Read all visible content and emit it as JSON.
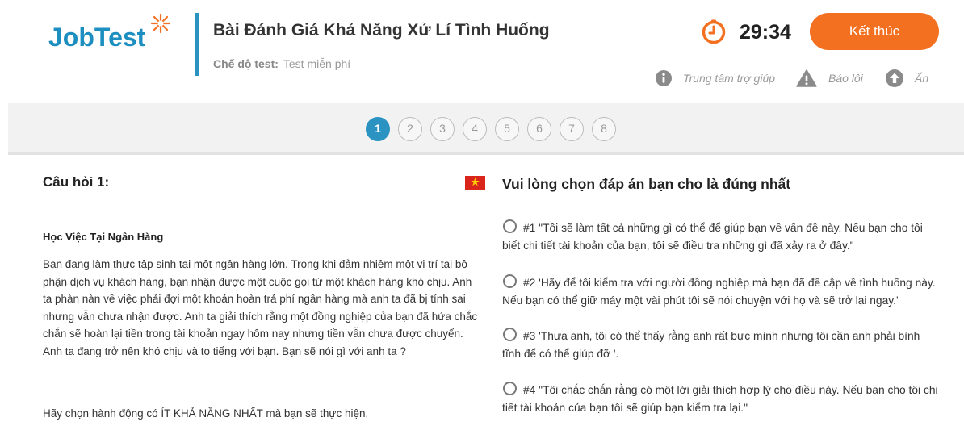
{
  "brand": {
    "logo_text": "JobTest",
    "accent": "#1c8fc0",
    "star_color": "#f37021"
  },
  "header": {
    "title": "Bài Đánh Giá Khả Năng Xử Lí Tình Huống",
    "mode_label": "Chế độ test:",
    "mode_value": "Test miễn phí",
    "timer": "29:34",
    "finish_button": "Kết thúc",
    "tools": {
      "help": {
        "label": "Trung tâm trợ giúp",
        "icon": "info-icon"
      },
      "report": {
        "label": "Báo lỗi",
        "icon": "warning-icon"
      },
      "hide": {
        "label": "Ẩn",
        "icon": "arrow-up-icon"
      }
    }
  },
  "pagination": {
    "pages": [
      "1",
      "2",
      "3",
      "4",
      "5",
      "6",
      "7",
      "8"
    ],
    "current": "1",
    "active_color": "#2b93c1"
  },
  "question": {
    "number_label": "Câu hỏi 1:",
    "language_flag": "vietnam-flag-icon",
    "scenario_title": "Học Việc Tại Ngân Hàng",
    "scenario_body": "Bạn đang làm thực tập sinh tại một ngân hàng lớn. Trong khi đảm nhiệm một vị trí tại bộ phận dịch vụ khách hàng, bạn nhận được một cuộc gọi từ một khách hàng khó chịu. Anh ta phàn nàn về việc phải đợi một khoản hoàn trả phí ngân hàng mà anh ta đã bị tính sai nhưng vẫn chưa nhận được. Anh ta giải thích rằng một đồng nghiệp của bạn đã hứa chắc chắn sẽ hoàn lại tiền trong tài khoản ngay hôm nay nhưng tiền vẫn chưa được chuyển. Anh ta đang trở nên khó chịu và to tiếng với bạn. Bạn sẽ nói gì với anh ta ?",
    "instruction": "Hãy chọn hành động có ÍT KHẢ NĂNG NHẤT mà bạn sẽ thực hiện."
  },
  "answers": {
    "title": "Vui lòng chọn đáp án bạn cho là đúng nhất",
    "options": [
      "#1 \"Tôi sẽ làm tất cả những gì có thể để giúp bạn về vấn đề này. Nếu bạn cho tôi biết chi tiết tài khoản của bạn, tôi sẽ điều tra những gì đã xảy ra ở đây.\"",
      "#2 'Hãy để tôi kiểm tra với người đồng nghiệp mà bạn đã đề cập về tình huống này. Nếu bạn có thể giữ máy một vài phút tôi sẽ nói chuyện với họ và sẽ trở lại ngay.'",
      "#3 'Thưa anh, tôi có thể thấy rằng anh rất bực mình nhưng tôi cần anh phải bình tĩnh để có thể giúp đỡ '.",
      "#4 \"Tôi chắc chắn rằng có một lời giải thích hợp lý cho điều này. Nếu bạn cho tôi chi tiết tài khoản của bạn tôi sẽ giúp bạn kiểm tra lại.\""
    ]
  }
}
